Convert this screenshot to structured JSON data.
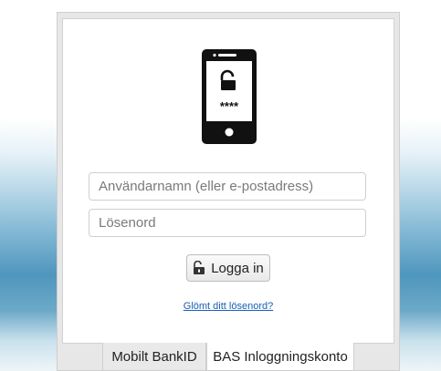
{
  "login": {
    "username_placeholder": "Användarnamn (eller e-postadress)",
    "password_placeholder": "Lösenord",
    "username_value": "",
    "password_value": "",
    "login_button_label": "Logga in",
    "forgot_password_link": "Glömt ditt lösenord?",
    "phone_screen_text": "****"
  },
  "tabs": [
    {
      "label": "Mobilt BankID",
      "active": false
    },
    {
      "label": "BAS Inloggningskonto",
      "active": true
    }
  ],
  "colors": {
    "link": "#1a5fb4",
    "phone": "#111111",
    "panel_background": "#ffffff"
  },
  "icons": {
    "hero": "phone-unlock-icon",
    "button": "unlock-icon"
  }
}
